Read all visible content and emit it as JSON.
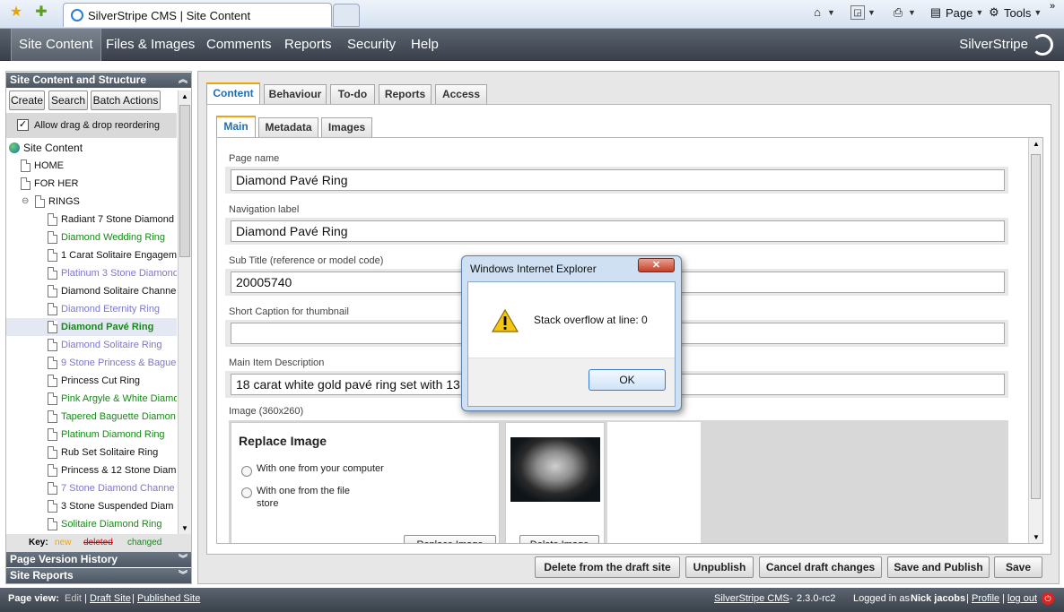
{
  "browser": {
    "tab_title": "SilverStripe CMS | Site Content",
    "page_menu": "Page",
    "tools_menu": "Tools"
  },
  "topnav": {
    "items": [
      "Site Content",
      "Files & Images",
      "Comments",
      "Reports",
      "Security",
      "Help"
    ],
    "brand": "SilverStripe"
  },
  "left": {
    "header": "Site Content and Structure",
    "buttons": [
      "Create",
      "Search",
      "Batch Actions"
    ],
    "drag_label": "Allow drag & drop reordering",
    "tree_root": "Site Content",
    "tree": [
      {
        "label": "HOME"
      },
      {
        "label": "FOR HER"
      },
      {
        "label": "RINGS"
      },
      {
        "label": "Radiant 7 Stone Diamond"
      },
      {
        "label": "Diamond Wedding Ring"
      },
      {
        "label": "1 Carat Solitaire Engagem"
      },
      {
        "label": "Platinum 3 Stone Diamond"
      },
      {
        "label": "Diamond Solitaire Channe"
      },
      {
        "label": "Diamond Eternity Ring"
      },
      {
        "label": "Diamond Pavé Ring"
      },
      {
        "label": "Diamond Solitaire Ring"
      },
      {
        "label": "9 Stone Princess & Bague"
      },
      {
        "label": "Princess Cut Ring"
      },
      {
        "label": "Pink Argyle & White Diamo"
      },
      {
        "label": "Tapered Baguette Diamon"
      },
      {
        "label": "Platinum Diamond Ring"
      },
      {
        "label": "Rub Set Solitaire Ring"
      },
      {
        "label": "Princess & 12 Stone Diam"
      },
      {
        "label": "7 Stone Diamond Channe"
      },
      {
        "label": "3 Stone Suspended Diam"
      },
      {
        "label": "Solitaire Diamond Ring"
      }
    ],
    "key_label": "Key:",
    "key_new": "new",
    "key_deleted": "deleted",
    "key_changed": "changed",
    "history_header": "Page Version History",
    "reports_header": "Site Reports"
  },
  "main": {
    "tabs": [
      "Content",
      "Behaviour",
      "To-do",
      "Reports",
      "Access"
    ],
    "subtabs": [
      "Main",
      "Metadata",
      "Images"
    ],
    "page_name_label": "Page name",
    "page_name": "Diamond Pavé Ring",
    "nav_label_label": "Navigation label",
    "nav_label": "Diamond Pavé Ring",
    "subtitle_label": "Sub Title (reference or model code)",
    "subtitle": "20005740",
    "caption_label": "Short Caption for thumbnail",
    "caption": "",
    "description_label": "Main Item Description",
    "description": "18 carat white gold pavé ring set with 13",
    "image_label": "Image (360x260)",
    "replace_title": "Replace Image",
    "replace_opt1": "With one from your computer",
    "replace_opt2": "With one from the file store",
    "replace_button": "Replace Image",
    "delete_image_button": "Delete Image",
    "actions": [
      "Delete from the draft site",
      "Unpublish",
      "Cancel draft changes",
      "Save and Publish",
      "Save"
    ]
  },
  "footer": {
    "page_view_label": "Page view:",
    "edit": "Edit",
    "draft_site": "Draft Site",
    "published_site": "Published Site",
    "cms_link": "SilverStripe CMS",
    "version": "2.3.0-rc2",
    "logged_in_prefix": "Logged in as",
    "user": "Nick jacobs",
    "profile": "Profile",
    "logout": "log out"
  },
  "dialog": {
    "title": "Windows Internet Explorer",
    "message": "Stack overflow at line: 0",
    "ok": "OK"
  },
  "colors": {
    "nav_bg": "#3a414b",
    "tree_new": "#168a16",
    "tree_changed": "#7c78c8",
    "tab_accent": "#1f6fb5"
  }
}
